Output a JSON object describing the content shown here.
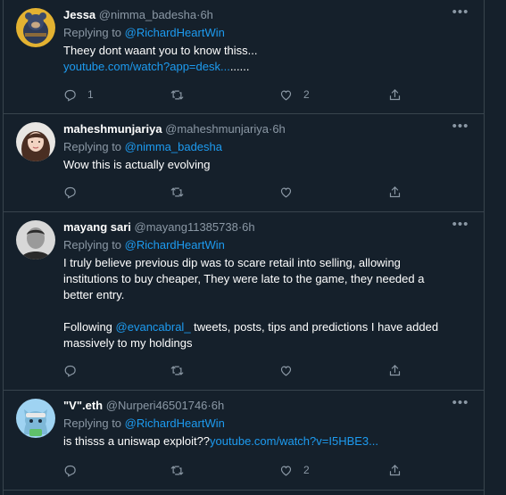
{
  "tweets": [
    {
      "name": "Jessa",
      "handle": "@nimma_badesha",
      "time": "6h",
      "replying_prefix": "Replying to",
      "replying_to": "@RichardHeartWin",
      "text_lines": [
        "Theey dont waant you to know thiss..."
      ],
      "link": "youtube.com/watch?app=desk...",
      "link_suffix": "......",
      "replies": "1",
      "retweets": "",
      "likes": "2"
    },
    {
      "name": "maheshmunjariya",
      "handle": "@maheshmunjariya",
      "time": "6h",
      "replying_prefix": "Replying to",
      "replying_to": "@nimma_badesha",
      "text_lines": [
        "Wow this is actually evolving"
      ],
      "replies": "",
      "retweets": "",
      "likes": ""
    },
    {
      "name": "mayang sari",
      "handle": "@mayang11385738",
      "time": "6h",
      "replying_prefix": "Replying to",
      "replying_to": "@RichardHeartWin",
      "text_lines": [
        "I truly believe previous dip was to scare retail into selling, allowing",
        "institutions to buy cheaper, They were late to the game, they needed a",
        "better entry."
      ],
      "text2_prefix": "Following ",
      "text2_mention": "@evancabral_",
      "text2_rest": " tweets, posts, tips and predictions I have added",
      "text2_line2": "massively to my holdings",
      "replies": "",
      "retweets": "",
      "likes": ""
    },
    {
      "name": "\"V\".eth",
      "handle": "@Nurperi46501746",
      "time": "6h",
      "replying_prefix": "Replying to",
      "replying_to": "@RichardHeartWin",
      "text_prefix": "is thisss a uniswap exploit??",
      "link": "youtube.com/watch?v=I5HBE3...",
      "replies": "",
      "retweets": "",
      "likes": "2"
    }
  ],
  "separator_dot": "·",
  "more_glyph": "•••",
  "icons": {
    "reply": "reply-icon",
    "retweet": "retweet-icon",
    "like": "heart-icon",
    "share": "share-icon"
  },
  "colors": {
    "background": "#15202b",
    "link": "#1d9bf0",
    "muted": "#8b98a5",
    "border": "#38444d"
  }
}
